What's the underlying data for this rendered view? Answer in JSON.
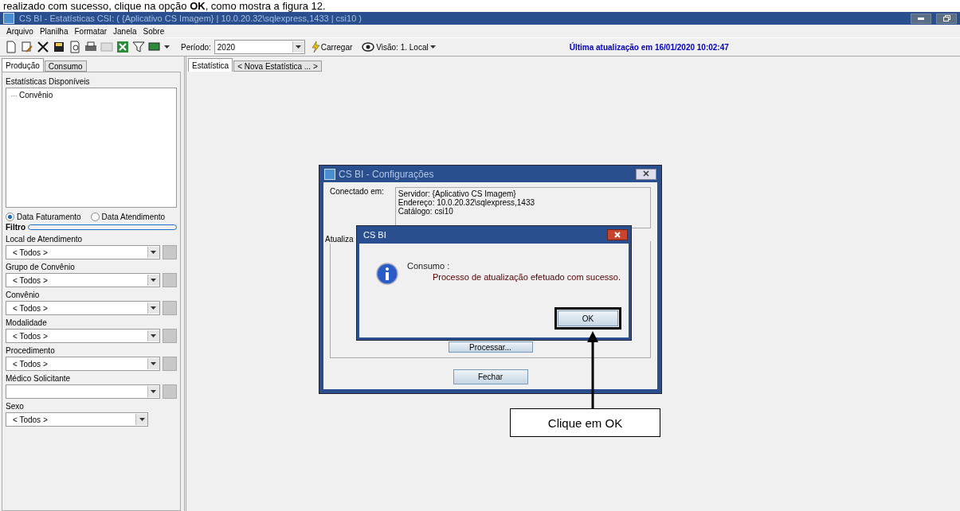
{
  "doc_text": "realizado com sucesso, clique na opção **OK**, como mostra a figura 12.",
  "window": {
    "title": "CS BI - Estatísticas CSI: ( {Aplicativo CS Imagem} | 10.0.20.32\\sqlexpress,1433 | csi10 )"
  },
  "menu": [
    "Arquivo",
    "Planilha",
    "Formatar",
    "Janela",
    "Sobre"
  ],
  "toolbar": {
    "period_label": "Período:",
    "period_value": "2020",
    "load": "Carregar",
    "view": "Visão: 1. Local",
    "last_update": "Última atualização em 16/01/2020 10:02:47"
  },
  "side_tabs": [
    {
      "label": "Produção",
      "selected": true
    },
    {
      "label": "Consumo",
      "selected": false
    }
  ],
  "stats": {
    "title": "Estatísticas Disponíveis",
    "items": [
      "Convênio"
    ]
  },
  "date_options": [
    {
      "label": "Data Faturamento",
      "selected": true
    },
    {
      "label": "Data Atendimento",
      "selected": false
    }
  ],
  "filter_title": "Filtro",
  "filters": [
    {
      "label": "Local de Atendimento",
      "value": "< Todos >",
      "kind": "picker"
    },
    {
      "label": "Grupo de Convênio",
      "value": "< Todos >",
      "kind": "picker"
    },
    {
      "label": "Convênio",
      "value": "< Todos >",
      "kind": "picker"
    },
    {
      "label": "Modalidade",
      "value": "< Todos >",
      "kind": "picker"
    },
    {
      "label": "Procedimento",
      "value": "< Todos >",
      "kind": "picker"
    },
    {
      "label": "Médico Solicitante",
      "kind": "picker"
    },
    {
      "label": "Sexo",
      "value": "< Todos >",
      "kind": "plain"
    }
  ],
  "main_tabs": [
    {
      "label": "Estatística",
      "selected": true
    },
    {
      "label": "< Nova Estatística ... >",
      "selected": false
    }
  ],
  "config_dialog": {
    "title": "CS BI - Configurações",
    "connected_label": "Conectado em:",
    "connection": [
      "Servidor: {Aplicativo CS Imagem}",
      "Endereço: 10.0.20.32\\sqlexpress,1433",
      "Catálogo: csi10"
    ],
    "tab_label": "Atualiza",
    "process_button": "Processar...",
    "close_button": "Fechar"
  },
  "message_box": {
    "title": "CS BI",
    "heading": "Consumo :",
    "message": "Processo de atualização efetuado com sucesso.",
    "ok_button": "OK"
  },
  "callout": "Clique em OK"
}
